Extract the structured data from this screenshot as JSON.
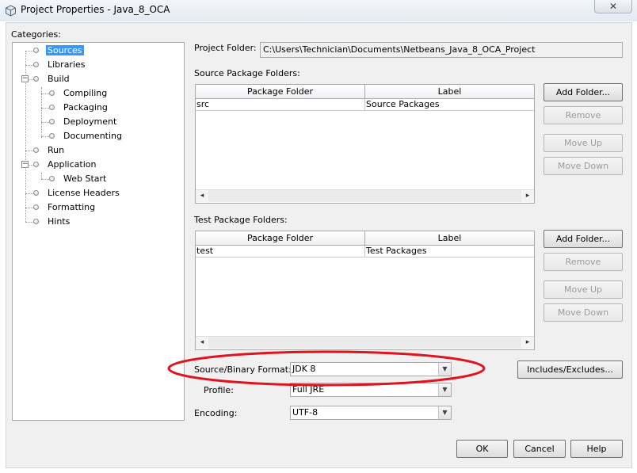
{
  "window": {
    "title": "Project Properties - Java_8_OCA",
    "close_glyph": "✕"
  },
  "categories": {
    "label": "Categories:",
    "items": [
      {
        "label": "Sources"
      },
      {
        "label": "Libraries"
      },
      {
        "label": "Build"
      },
      {
        "label": "Compiling"
      },
      {
        "label": "Packaging"
      },
      {
        "label": "Deployment"
      },
      {
        "label": "Documenting"
      },
      {
        "label": "Run"
      },
      {
        "label": "Application"
      },
      {
        "label": "Web Start"
      },
      {
        "label": "License Headers"
      },
      {
        "label": "Formatting"
      },
      {
        "label": "Hints"
      }
    ],
    "expand_glyph": "−"
  },
  "project_folder": {
    "label": "Project Folder:",
    "value": "C:\\Users\\Technician\\Documents\\Netbeans_Java_8_OCA_Project"
  },
  "source_packages": {
    "label": "Source Package Folders:",
    "columns": [
      "Package Folder",
      "Label"
    ],
    "rows": [
      {
        "folder": "src",
        "label": "Source Packages"
      }
    ],
    "buttons": {
      "add": "Add Folder...",
      "remove": "Remove",
      "move_up": "Move Up",
      "move_down": "Move Down"
    }
  },
  "test_packages": {
    "label": "Test Package Folders:",
    "columns": [
      "Package Folder",
      "Label"
    ],
    "rows": [
      {
        "folder": "test",
        "label": "Test Packages"
      }
    ],
    "buttons": {
      "add": "Add Folder...",
      "remove": "Remove",
      "move_up": "Move Up",
      "move_down": "Move Down"
    }
  },
  "scroll_glyphs": {
    "left": "◂",
    "right": "▸"
  },
  "format": {
    "label": "Source/Binary Format:",
    "value": "JDK 8",
    "includes_button": "Includes/Excludes...",
    "highlight_color": "#e0141e"
  },
  "profile": {
    "label": "Profile:",
    "value": "Full JRE"
  },
  "encoding": {
    "label": "Encoding:",
    "value": "UTF-8"
  },
  "combo_arrow_glyph": "▼",
  "footer": {
    "ok": "OK",
    "cancel": "Cancel",
    "help": "Help"
  }
}
